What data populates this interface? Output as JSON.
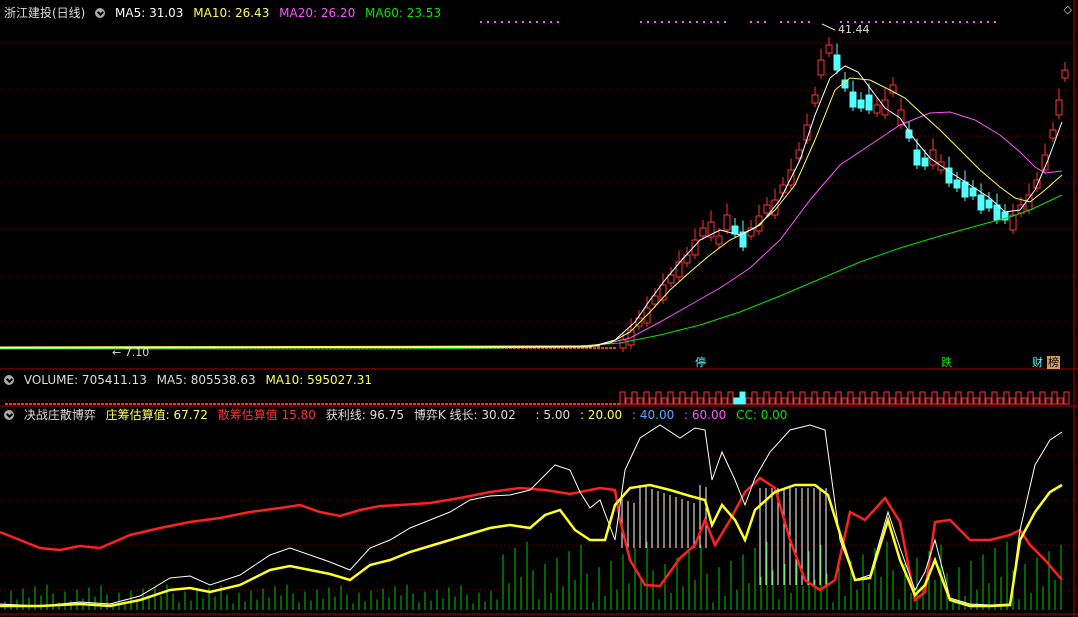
{
  "main": {
    "title": "浙江建投(日线)",
    "ma5": "MA5: 31.03",
    "ma10": "MA10: 26.43",
    "ma20": "MA20: 26.20",
    "ma60": "MA60: 23.53",
    "high_label": "41.44",
    "low_label": "7.10",
    "tags": {
      "t1": "停",
      "t2": "跌",
      "t3": "财",
      "t4": "榜"
    },
    "colors": {
      "up": "#ff3232",
      "down": "#54ffff",
      "ma5": "#ffffff",
      "ma10": "#ffff54",
      "ma20": "#ff54ff",
      "ma60": "#00e600"
    }
  },
  "volume": {
    "label": "VOLUME: 705411.13",
    "ma5": "MA5: 805538.63",
    "ma10": "MA10: 595027.31"
  },
  "indicator": {
    "name": "决战庄散博弈",
    "zhuang_label": "庄筹估算值:",
    "zhuang_val": "67.72",
    "san_label": "散筹估算值",
    "san_val": "15.80",
    "huoli": "获利线: 96.75",
    "boyi": "博弈K 线长: 30.02",
    "c1": ": 5.00",
    "c2": ": 20.00",
    "c3": ": 40.00",
    "c4": ": 60.00",
    "cc": "CC: 0.00"
  }
}
